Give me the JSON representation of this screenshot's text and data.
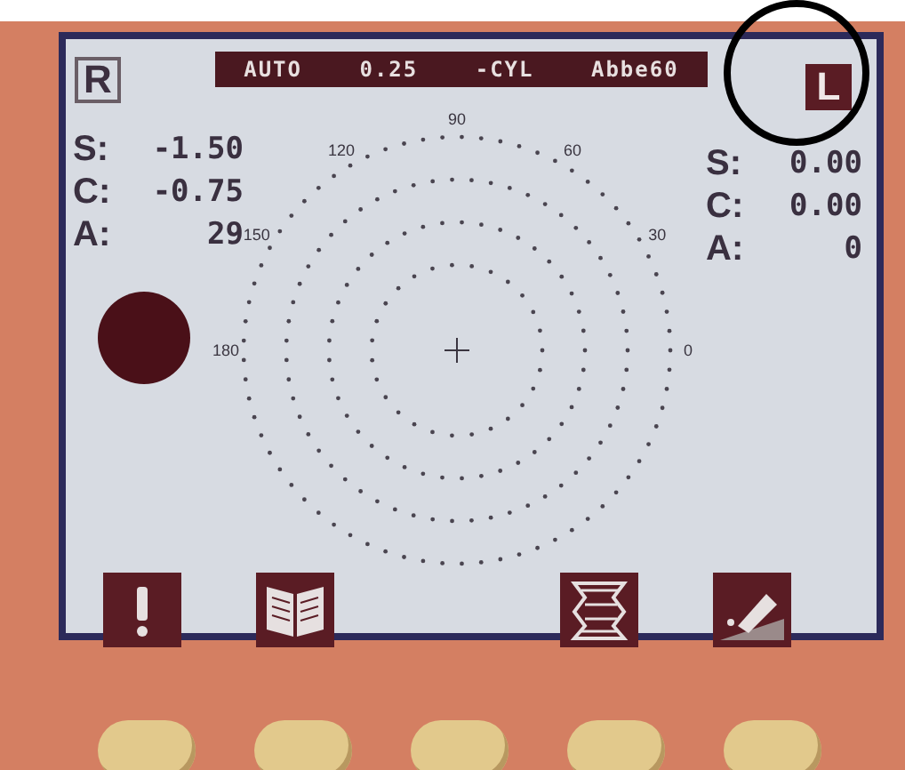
{
  "lenses": [
    {
      "label": "R",
      "selected": false
    },
    {
      "label": "L",
      "selected": true
    }
  ],
  "status_bar": [
    "AUTO",
    "0.25",
    "-CYL",
    "Abbe60"
  ],
  "left_readings": [
    {
      "label": "S:",
      "value": "-1.50"
    },
    {
      "label": "C:",
      "value": "-0.75"
    },
    {
      "label": "A:",
      "value": "29"
    }
  ],
  "right_readings": [
    {
      "label": "S:",
      "value": "0.00"
    },
    {
      "label": "C:",
      "value": "0.00"
    },
    {
      "label": "A:",
      "value": "0"
    }
  ],
  "axis_labels": [
    "0",
    "30",
    "60",
    "90",
    "120",
    "150",
    "180"
  ],
  "soft_keys": [
    {
      "kind": "alert"
    },
    {
      "kind": "book"
    },
    {
      "kind": "empty"
    },
    {
      "kind": "zigzag"
    },
    {
      "kind": "eraser"
    }
  ]
}
